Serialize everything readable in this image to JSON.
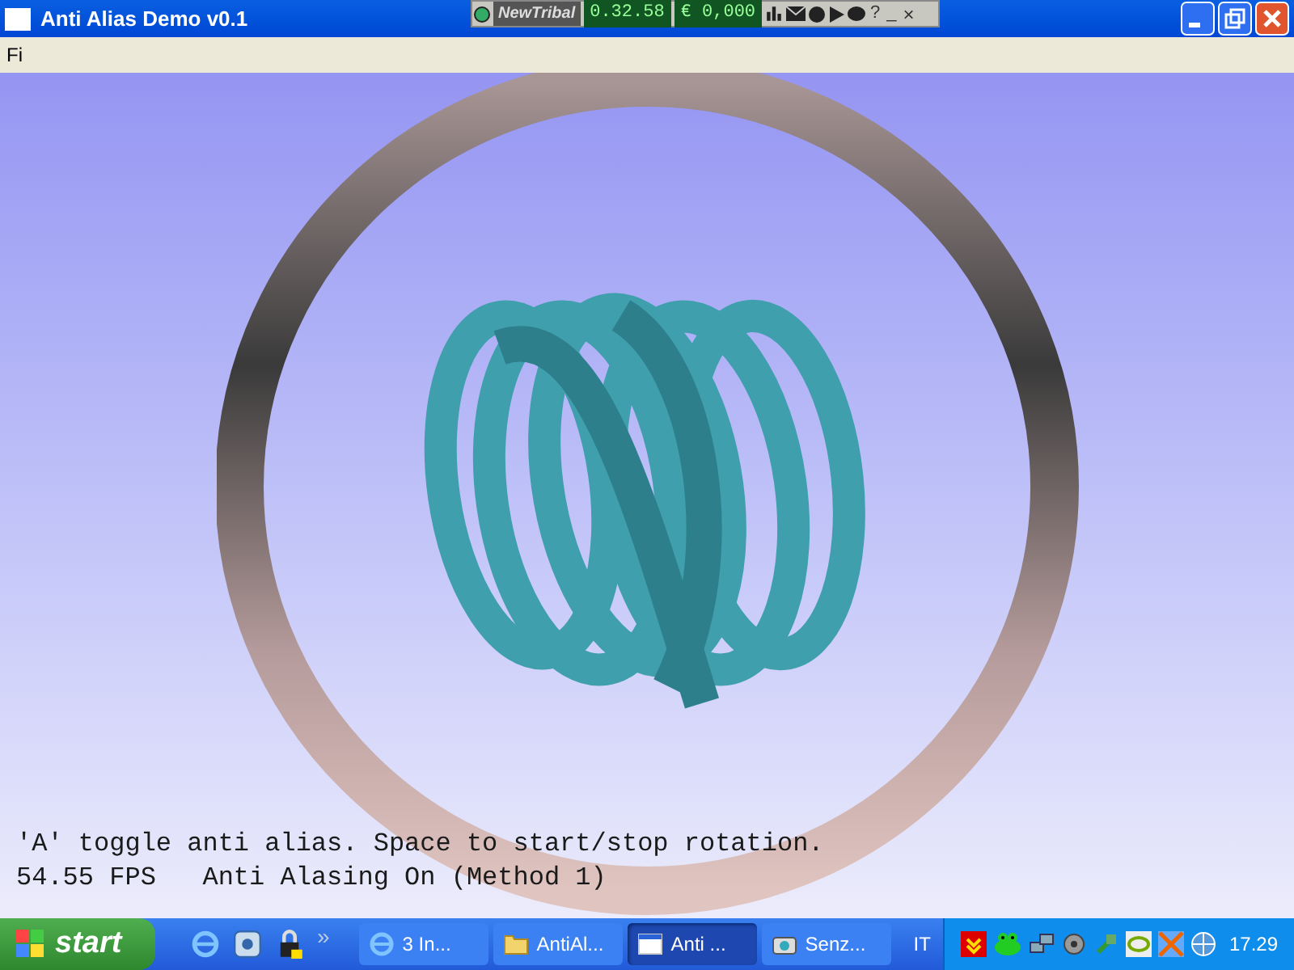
{
  "window": {
    "title": "Anti Alias Demo v0.1"
  },
  "toolbar_widget": {
    "name": "NewTribal",
    "timer": "0.32.58",
    "credit": "€ 0,000",
    "help": "?",
    "minimize": "_",
    "close": "×"
  },
  "menu": [
    "Fi"
  ],
  "overlay_text": [
    "'A' toggle anti alias. Space to start/stop rotation.",
    "54.55 FPS   Anti Alasing On (Method 1)"
  ],
  "taskbar": {
    "start": "start",
    "more": "»",
    "tasks": [
      {
        "label": "3 In...",
        "kind": "browser",
        "selected": false
      },
      {
        "label": "AntiAl...",
        "kind": "folder",
        "selected": false
      },
      {
        "label": "Anti ...",
        "kind": "window",
        "selected": true
      },
      {
        "label": "Senz...",
        "kind": "camera",
        "selected": false
      }
    ],
    "language": "IT",
    "clock": "17.29"
  }
}
